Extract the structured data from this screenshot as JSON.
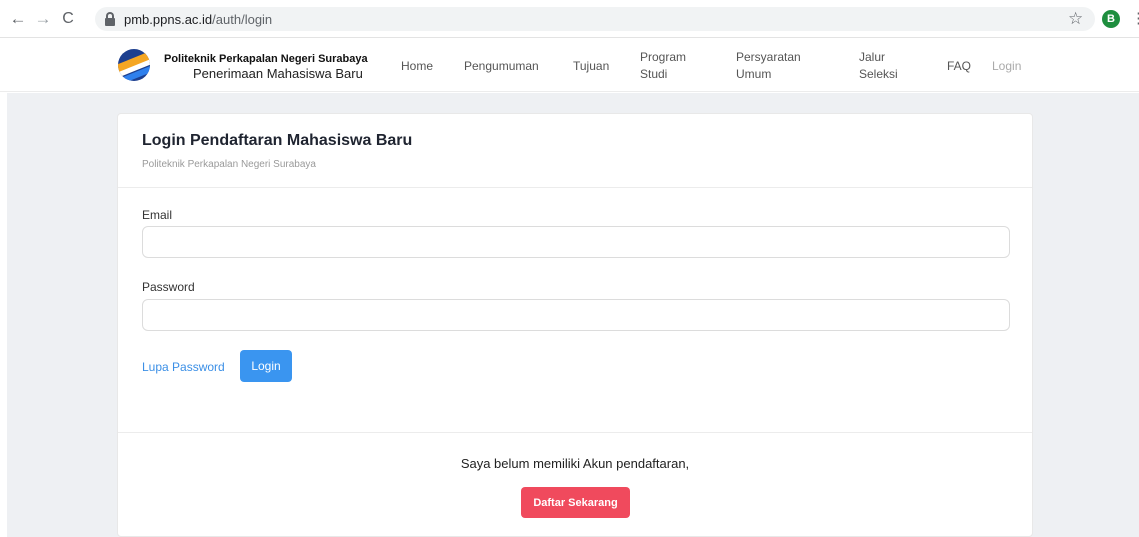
{
  "browser": {
    "url_host": "pmb.ppns.ac.id",
    "url_path": "/auth/login",
    "avatar_letter": "B",
    "back_glyph": "←",
    "forward_glyph": "→",
    "reload_glyph": "C",
    "star_glyph": "☆",
    "menu_glyph": "⋮"
  },
  "header": {
    "brand_title": "Politeknik Perkapalan Negeri Surabaya",
    "brand_subtitle": "Penerimaan Mahasiswa Baru",
    "nav": {
      "home": "Home",
      "pengumuman": "Pengumuman",
      "tujuan": "Tujuan",
      "program_1": "Program",
      "program_2": "Studi",
      "persyaratan_1": "Persyaratan",
      "persyaratan_2": "Umum",
      "jalur_1": "Jalur",
      "jalur_2": "Seleksi",
      "faq": "FAQ",
      "login": "Login"
    }
  },
  "login_card": {
    "title": "Login Pendaftaran Mahasiswa Baru",
    "subtitle": "Politeknik Perkapalan Negeri Surabaya",
    "email_label": "Email",
    "email_value": "",
    "password_label": "Password",
    "password_value": "",
    "forgot_password": "Lupa Password",
    "login_button": "Login",
    "register_prompt": "Saya belum memiliki Akun pendaftaran,",
    "register_button": "Daftar Sekarang"
  },
  "colors": {
    "primary_button": "#3a95f0",
    "register_button": "#f04a5d",
    "link": "#3b8fe6",
    "page_background": "#eef0f3"
  }
}
